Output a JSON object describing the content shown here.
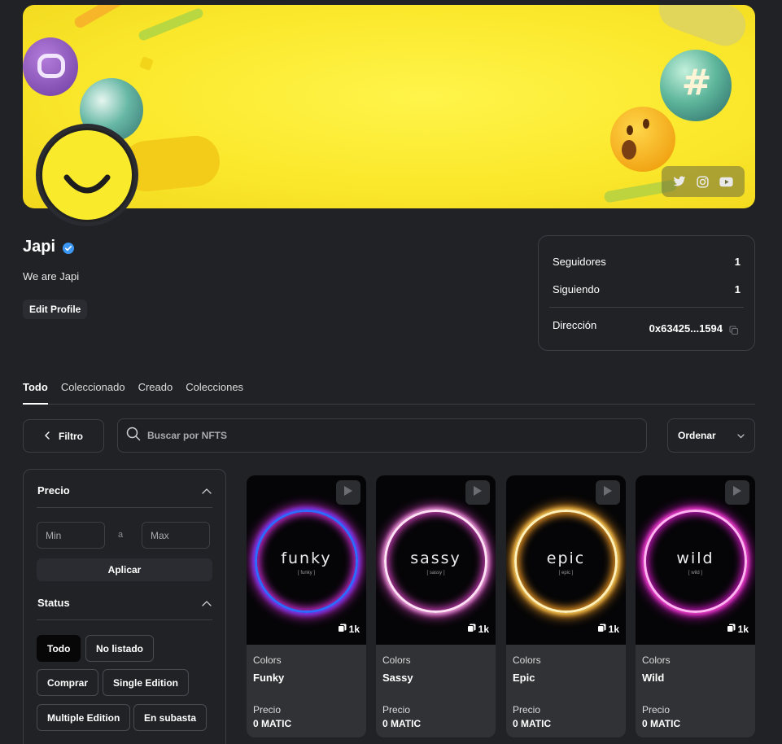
{
  "profile": {
    "name": "Japi",
    "bio": "We are Japi",
    "edit_label": "Edit Profile",
    "verified_icon": "verified-badge-icon",
    "accent": "#3b97f3"
  },
  "banner": {
    "background": "#fbe82c",
    "social_icons": [
      "twitter-icon",
      "instagram-icon",
      "youtube-icon"
    ]
  },
  "stats": {
    "followers_label": "Seguidores",
    "followers_value": "1",
    "following_label": "Siguiendo",
    "following_value": "1",
    "address_label": "Dirección",
    "address_value": "0x63425...1594"
  },
  "tabs": [
    "Todo",
    "Coleccionado",
    "Creado",
    "Colecciones"
  ],
  "toolbar": {
    "filter_label": "Filtro",
    "search_placeholder": "Buscar por NFTS",
    "sort_label": "Ordenar"
  },
  "filters": {
    "price_title": "Precio",
    "min_placeholder": "Min",
    "separator": "a",
    "max_placeholder": "Max",
    "apply_label": "Aplicar",
    "status_title": "Status",
    "status_options": [
      "Todo",
      "No listado",
      "Comprar",
      "Single Edition",
      "Multiple Edition",
      "En subasta"
    ],
    "active_status": "Todo"
  },
  "nfts": [
    {
      "collection": "Colors",
      "name": "Funky",
      "art_word": "funky",
      "art_sub": "[ funky ]",
      "edition": "1k",
      "price_label": "Precio",
      "price": "0 MATIC",
      "ring_colors": [
        "#6a3cff",
        "#d12bd6",
        "#2f6bff"
      ]
    },
    {
      "collection": "Colors",
      "name": "Sassy",
      "art_word": "sassy",
      "art_sub": "[ sassy ]",
      "edition": "1k",
      "price_label": "Precio",
      "price": "0 MATIC",
      "ring_colors": [
        "#f4a8e0",
        "#c63db3",
        "#ffe0f5"
      ]
    },
    {
      "collection": "Colors",
      "name": "Epic",
      "art_word": "epic",
      "art_sub": "[ epic ]",
      "edition": "1k",
      "price_label": "Precio",
      "price": "0 MATIC",
      "ring_colors": [
        "#ffcf5a",
        "#f29a22",
        "#fff0b8"
      ]
    },
    {
      "collection": "Colors",
      "name": "Wild",
      "art_word": "wild",
      "art_sub": "[ wild ]",
      "edition": "1k",
      "price_label": "Precio",
      "price": "0 MATIC",
      "ring_colors": [
        "#ff46d8",
        "#c415b8",
        "#ffb3f1"
      ]
    }
  ]
}
